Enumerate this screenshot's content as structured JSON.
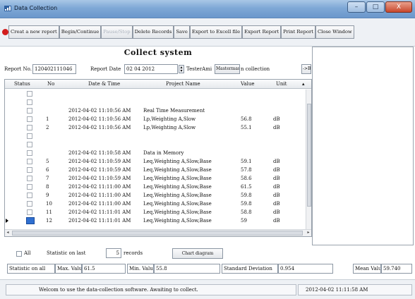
{
  "window": {
    "title": "Data Collection",
    "buttons": {
      "minimize": "–",
      "maximize": "□",
      "close": "X"
    }
  },
  "toolbar": {
    "items": [
      {
        "label": "Creat a new report",
        "enabled": true
      },
      {
        "label": "Begin/Continue",
        "enabled": true
      },
      {
        "label": "Pause/Stop",
        "enabled": false
      },
      {
        "label": "Delete Records",
        "enabled": true
      },
      {
        "label": "Save",
        "enabled": true
      },
      {
        "label": "Export to Excell file",
        "enabled": true
      },
      {
        "label": "Export Report",
        "enabled": true
      },
      {
        "label": "Print Report",
        "enabled": true
      },
      {
        "label": "Close Window",
        "enabled": true
      }
    ]
  },
  "panel": {
    "title": "Collect system",
    "report_no_label": "Report No.",
    "report_no": "120402111046",
    "report_date_label": "Report Date",
    "report_date": "02 04 2012",
    "tester_label": "TesterAmi",
    "tester_value": "Mastermaster",
    "collection_label": "n collection",
    "nav_next": "->B"
  },
  "table": {
    "columns": [
      "Status",
      "No",
      "Date & Time",
      "Project Name",
      "Value",
      "Unit"
    ],
    "rows": [
      {
        "no": "",
        "datetime": "",
        "project": "",
        "value": "",
        "unit": ""
      },
      {
        "no": "",
        "datetime": "",
        "project": "",
        "value": "",
        "unit": ""
      },
      {
        "no": "",
        "datetime": "2012-04-02 11:10:56 AM",
        "project": "Real Time Measurement",
        "value": "",
        "unit": ""
      },
      {
        "no": "1",
        "datetime": "2012-04-02 11:10:56 AM",
        "project": "Lp,Weighting A,Slow",
        "value": "56.8",
        "unit": "dB"
      },
      {
        "no": "2",
        "datetime": "2012-04-02 11:10:56 AM",
        "project": "Lp,Weighting A,Slow",
        "value": "55.1",
        "unit": "dB"
      },
      {
        "no": "",
        "datetime": "",
        "project": "",
        "value": "",
        "unit": ""
      },
      {
        "no": "",
        "datetime": "",
        "project": "",
        "value": "",
        "unit": ""
      },
      {
        "no": "",
        "datetime": "2012-04-02 11:10:58 AM",
        "project": "Data in Memory",
        "value": "",
        "unit": ""
      },
      {
        "no": "5",
        "datetime": "2012-04-02 11:10:59 AM",
        "project": "Leq,Weighting A,Slow,Base",
        "value": "59.1",
        "unit": "dB"
      },
      {
        "no": "6",
        "datetime": "2012-04-02 11:10:59 AM",
        "project": "Leq,Weighting A,Slow,Base",
        "value": "57.8",
        "unit": "dB"
      },
      {
        "no": "7",
        "datetime": "2012-04-02 11:10:59 AM",
        "project": "Leq,Weighting A,Slow,Base",
        "value": "58.6",
        "unit": "dB"
      },
      {
        "no": "8",
        "datetime": "2012-04-02 11:11:00 AM",
        "project": "Leq,Weighting A,Slow,Base",
        "value": "61.5",
        "unit": "dB"
      },
      {
        "no": "9",
        "datetime": "2012-04-02 11:11:00 AM",
        "project": "Leq,Weighting A,Slow,Base",
        "value": "59.8",
        "unit": "dB"
      },
      {
        "no": "10",
        "datetime": "2012-04-02 11:11:00 AM",
        "project": "Leq,Weighting A,Slow,Base",
        "value": "59.8",
        "unit": "dB"
      },
      {
        "no": "11",
        "datetime": "2012-04-02 11:11:01 AM",
        "project": "Leq,Weighting A,Slow,Base",
        "value": "58.8",
        "unit": "dB"
      },
      {
        "no": "12",
        "datetime": "2012-04-02 11:11:01 AM",
        "project": "Leq,Weighting A,Slow,Base",
        "value": "59",
        "unit": "dB"
      }
    ],
    "selected_index": 15
  },
  "stats": {
    "all_label": "All",
    "last_label": "Statistic on last",
    "last_count": "5",
    "records_label": "records",
    "chart_button": "Chart diagram",
    "summary": {
      "all_label": "Statistic on all",
      "max_label": "Max. Value",
      "max_value": "61.5",
      "min_label": "Min. Value",
      "min_value": "55.8",
      "std_label": "Standard Deviation",
      "std_value": "0.954",
      "mean_label": "Mean Value",
      "mean_value": "59.740"
    }
  },
  "status_bar": {
    "message": "Welcom to use the data-collection software. Awaiting to collect.",
    "timestamp": "2012-04-02 11:11:58 AM"
  },
  "colors": {
    "title_bar": "#7fa8d6",
    "stop_indicator": "#d21c1c",
    "selection": "#2f6fd0"
  }
}
